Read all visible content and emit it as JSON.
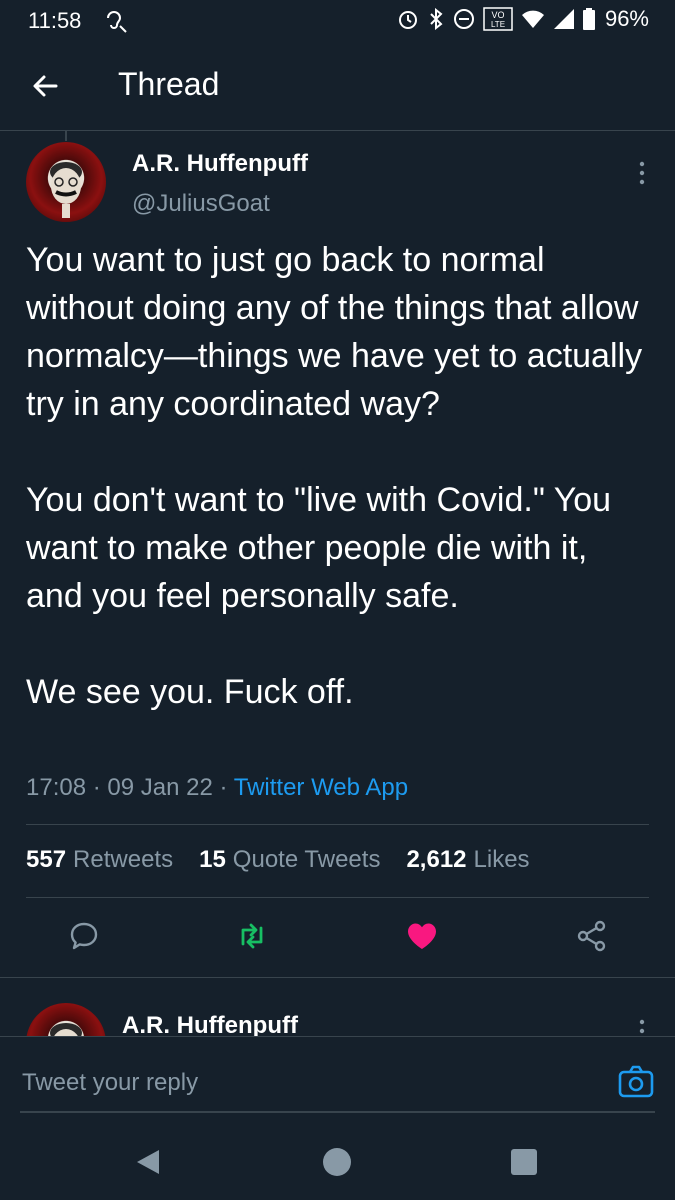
{
  "status_bar": {
    "time": "11:58",
    "battery": "96%",
    "network_badge": "VO LTE"
  },
  "header": {
    "title": "Thread"
  },
  "tweet": {
    "author_name": "A.R. Huffenpuff",
    "author_handle": "@JuliusGoat",
    "text": "You want to just go back to normal without doing any of the things that allow normalcy—things we have yet to actually try in any coordinated way?\n\nYou don't want to \"live with Covid.\" You want to make other people die with it, and you feel personally safe.\n\nWe see you. Fuck off.",
    "time": "17:08",
    "date": "09 Jan 22",
    "separator": "·",
    "source": "Twitter Web App",
    "stats": {
      "retweets_count": "557",
      "retweets_label": "Retweets",
      "quotes_count": "15",
      "quotes_label": "Quote Tweets",
      "likes_count": "2,612",
      "likes_label": "Likes"
    }
  },
  "reply_preview": {
    "author_name": "A.R. Huffenpuff"
  },
  "composer": {
    "placeholder": "Tweet your reply"
  },
  "icons": {
    "back": "arrow-left-icon",
    "more": "more-vertical-icon",
    "reply": "comment-icon",
    "retweet": "retweet-icon",
    "like": "heart-icon",
    "share": "share-icon",
    "camera": "camera-icon"
  },
  "colors": {
    "background": "#15202b",
    "link": "#1d9bf0",
    "retweet_active": "#17bf63",
    "like_active": "#f91880",
    "secondary_text": "#8899a6"
  }
}
